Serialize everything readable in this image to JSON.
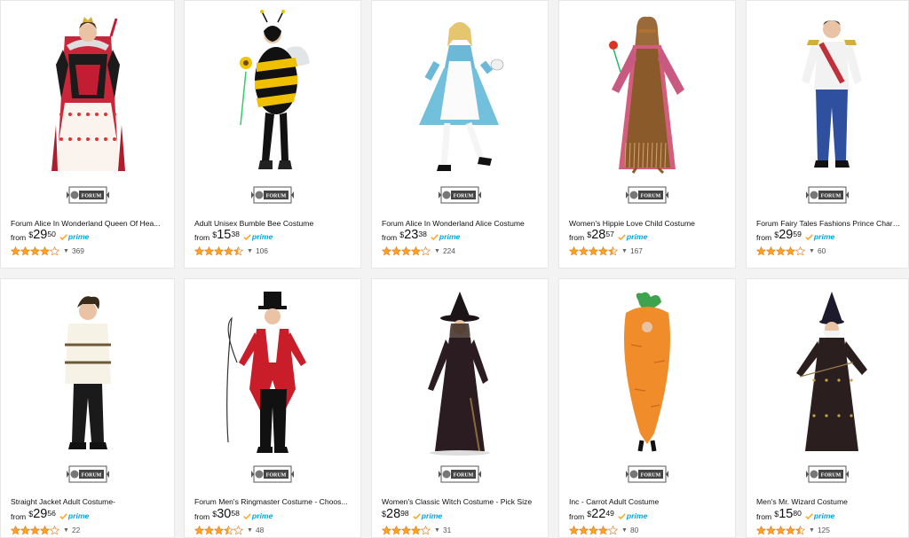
{
  "brand": {
    "logo_text": "FORUM"
  },
  "labels": {
    "from": "from",
    "currency": "$",
    "prime": "prime"
  },
  "colors": {
    "star": "#ffa41c",
    "prime": "#00a8e1",
    "background": "#f3f3f3"
  },
  "products": [
    {
      "title": "Forum Alice In Wonderland Queen Of Hea...",
      "has_from": true,
      "dollars": "29",
      "cents": "50",
      "rating": 4,
      "reviews": "369",
      "image": "queen-of-hearts-costume"
    },
    {
      "title": "Adult Unisex Bumble Bee Costume",
      "has_from": true,
      "dollars": "15",
      "cents": "38",
      "rating": 4.5,
      "reviews": "106",
      "image": "bumble-bee-costume"
    },
    {
      "title": "Forum Alice In Wonderland Alice Costume",
      "has_from": true,
      "dollars": "23",
      "cents": "38",
      "rating": 4,
      "reviews": "224",
      "image": "alice-costume"
    },
    {
      "title": "Women's Hippie Love Child Costume",
      "has_from": true,
      "dollars": "28",
      "cents": "57",
      "rating": 4.5,
      "reviews": "167",
      "image": "hippie-costume"
    },
    {
      "title": "Forum Fairy Tales Fashions Prince Charmi...",
      "has_from": true,
      "dollars": "29",
      "cents": "59",
      "rating": 4,
      "reviews": "60",
      "image": "prince-costume"
    },
    {
      "title": "Straight Jacket Adult Costume-",
      "has_from": true,
      "dollars": "29",
      "cents": "56",
      "rating": 4,
      "reviews": "22",
      "image": "straight-jacket-costume"
    },
    {
      "title": "Forum Men's Ringmaster Costume - Choos...",
      "has_from": true,
      "dollars": "30",
      "cents": "58",
      "rating": 3.5,
      "reviews": "48",
      "image": "ringmaster-costume"
    },
    {
      "title": "Women's Classic Witch Costume - Pick Size",
      "has_from": false,
      "dollars": "28",
      "cents": "98",
      "rating": 4,
      "reviews": "31",
      "image": "witch-costume"
    },
    {
      "title": "Inc - Carrot Adult Costume",
      "has_from": true,
      "dollars": "22",
      "cents": "49",
      "rating": 4,
      "reviews": "80",
      "image": "carrot-costume"
    },
    {
      "title": "Men's Mr. Wizard Costume",
      "has_from": true,
      "dollars": "15",
      "cents": "80",
      "rating": 4.5,
      "reviews": "125",
      "image": "wizard-costume"
    }
  ]
}
